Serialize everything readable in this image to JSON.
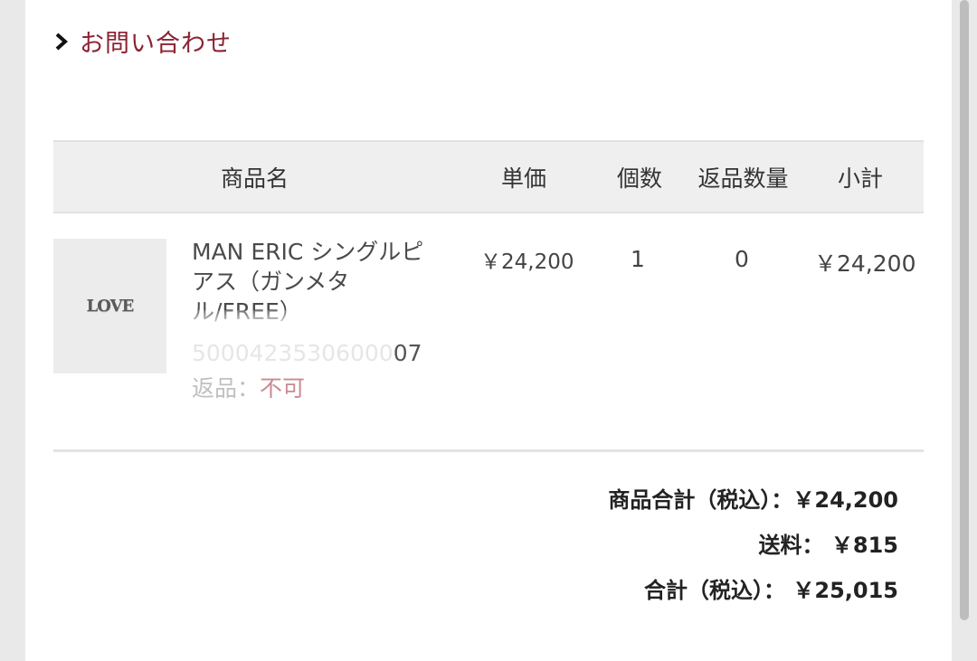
{
  "contact": {
    "label": "お問い合わせ"
  },
  "table": {
    "headers": {
      "product_name": "商品名",
      "unit_price": "単価",
      "quantity": "個数",
      "return_quantity": "返品数量",
      "subtotal": "小計"
    },
    "rows": [
      {
        "thumbnail_text": "LOVE",
        "name": "MAN ERIC シングルピアス（ガンメタル/FREE）",
        "code_faded": "50004235306000",
        "code_tail": "07",
        "return_label": "返品：",
        "return_value": "不可",
        "unit_price": "￥24,200",
        "quantity": "1",
        "return_quantity": "0",
        "subtotal": "￥24,200"
      }
    ]
  },
  "totals": {
    "items_total": "商品合計（税込）：￥24,200",
    "shipping": "送料： ￥815",
    "grand_total": "合計（税込）： ￥25,015"
  },
  "colors": {
    "accent": "#8b2332",
    "header_bg": "#efefef"
  }
}
